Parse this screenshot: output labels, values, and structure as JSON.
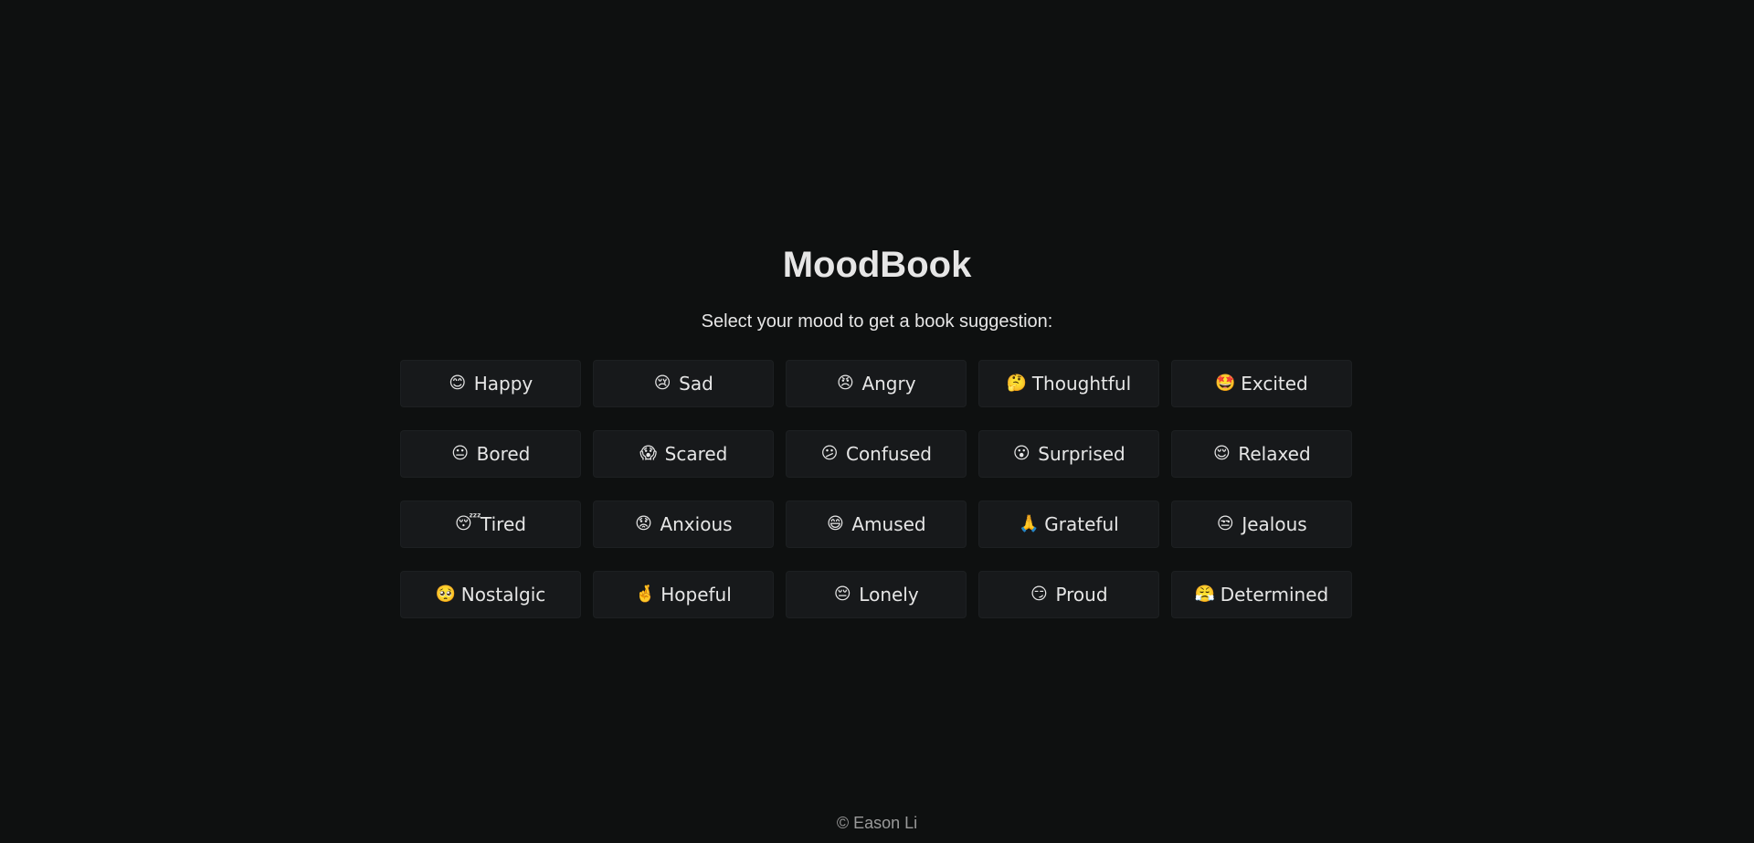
{
  "app": {
    "title": "MoodBook",
    "subtitle": "Select your mood to get a book suggestion:",
    "footer": "© Eason Li"
  },
  "moods": [
    {
      "label": "Happy",
      "emoji": "😊",
      "icon": "smiling-face-icon"
    },
    {
      "label": "Sad",
      "emoji": "😢",
      "icon": "crying-face-icon"
    },
    {
      "label": "Angry",
      "emoji": "😠",
      "icon": "angry-face-icon"
    },
    {
      "label": "Thoughtful",
      "emoji": "🤔",
      "icon": "thinking-face-icon"
    },
    {
      "label": "Excited",
      "emoji": "🤩",
      "icon": "star-struck-face-icon"
    },
    {
      "label": "Bored",
      "emoji": "😐",
      "icon": "neutral-face-icon"
    },
    {
      "label": "Scared",
      "emoji": "😱",
      "icon": "screaming-face-icon"
    },
    {
      "label": "Confused",
      "emoji": "😕",
      "icon": "confused-face-icon"
    },
    {
      "label": "Surprised",
      "emoji": "😮",
      "icon": "open-mouth-face-icon"
    },
    {
      "label": "Relaxed",
      "emoji": "😌",
      "icon": "relieved-face-icon"
    },
    {
      "label": "Tired",
      "emoji": "😴",
      "icon": "sleeping-face-icon"
    },
    {
      "label": "Anxious",
      "emoji": "😟",
      "icon": "worried-face-icon"
    },
    {
      "label": "Amused",
      "emoji": "😄",
      "icon": "grinning-face-icon"
    },
    {
      "label": "Grateful",
      "emoji": "🙏",
      "icon": "folded-hands-icon"
    },
    {
      "label": "Jealous",
      "emoji": "😒",
      "icon": "unamused-face-icon"
    },
    {
      "label": "Nostalgic",
      "emoji": "🥺",
      "icon": "pleading-face-icon"
    },
    {
      "label": "Hopeful",
      "emoji": "🤞",
      "icon": "crossed-fingers-icon"
    },
    {
      "label": "Lonely",
      "emoji": "😔",
      "icon": "pensive-face-icon"
    },
    {
      "label": "Proud",
      "emoji": "😏",
      "icon": "smirking-face-icon"
    },
    {
      "label": "Determined",
      "emoji": "😤",
      "icon": "steam-face-icon"
    }
  ],
  "colors": {
    "background": "#0e1010",
    "button": "#17191b",
    "text": "#e6e6e6",
    "footer_text": "#9a9a9a"
  }
}
